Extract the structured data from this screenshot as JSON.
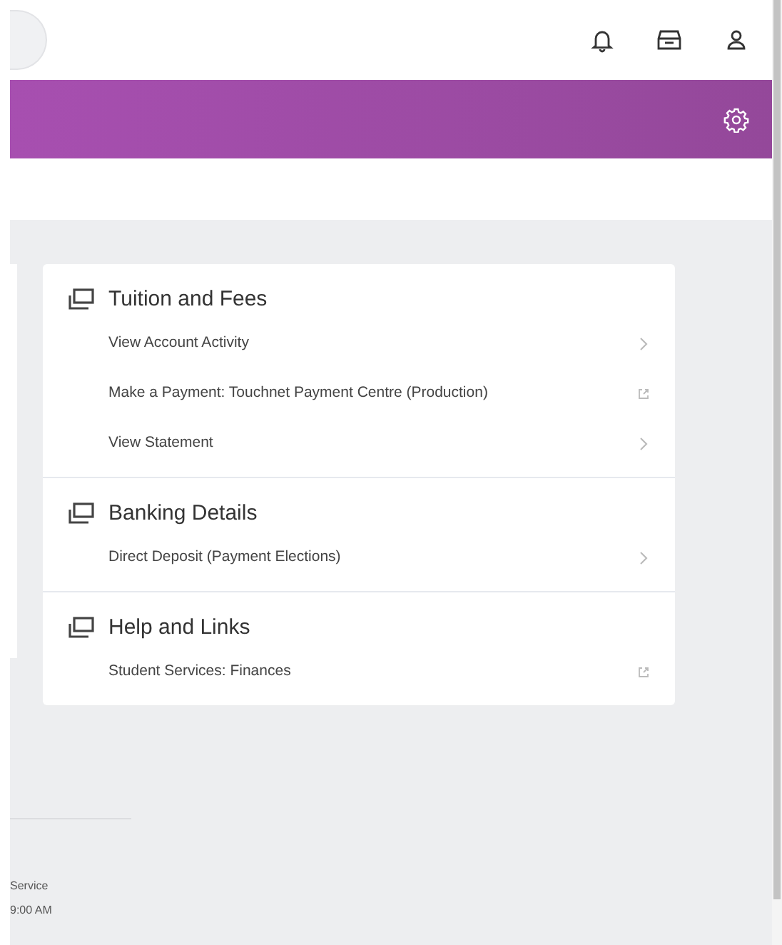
{
  "sections": [
    {
      "title": "Tuition and Fees",
      "links": [
        {
          "label": "View Account Activity",
          "kind": "internal"
        },
        {
          "label": "Make a Payment: Touchnet Payment Centre (Production)",
          "kind": "external"
        },
        {
          "label": "View Statement",
          "kind": "internal"
        }
      ]
    },
    {
      "title": "Banking Details",
      "links": [
        {
          "label": "Direct Deposit (Payment Elections)",
          "kind": "internal"
        }
      ]
    },
    {
      "title": "Help and Links",
      "links": [
        {
          "label": "Student Services: Finances",
          "kind": "external"
        }
      ]
    }
  ],
  "footer": {
    "lines": [
      "Service",
      "9:00 AM"
    ]
  }
}
